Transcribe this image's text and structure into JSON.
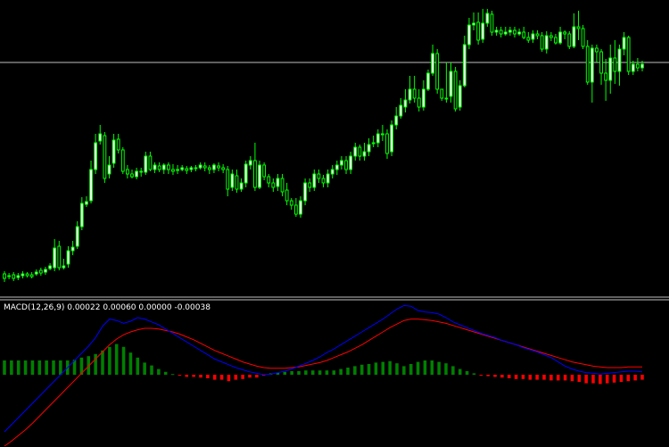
{
  "colors": {
    "background": "#000000",
    "bull_candle": "#ffffff",
    "bear_candle": "#000000",
    "candle_outline": "#00ff00",
    "hline": "#c0c0c0",
    "separator": "#c0c0c0",
    "hist_up": "#008000",
    "hist_down": "#ff0000",
    "macd_line": "#0000ff",
    "signal_line": "#ff0000",
    "label_text": "#ffffff"
  },
  "macd_label": {
    "name": "MACD(12,26,9)",
    "values": "0.00022 0.00060 0.00000 -0.00038"
  },
  "chart_data": [
    {
      "type": "candlestick",
      "hline_level": 70,
      "ylim": [
        0,
        330
      ],
      "candles": [
        [
          307,
          312,
          316,
          304
        ],
        [
          309,
          310,
          313,
          306
        ],
        [
          308,
          312,
          315,
          305
        ],
        [
          311,
          309,
          314,
          306
        ],
        [
          309,
          307,
          312,
          304
        ],
        [
          307,
          309,
          311,
          305
        ],
        [
          308,
          310,
          312,
          305
        ],
        [
          307,
          305,
          309,
          302
        ],
        [
          303,
          306,
          309,
          300
        ],
        [
          305,
          302,
          308,
          299
        ],
        [
          301,
          298,
          303,
          295
        ],
        [
          300,
          278,
          304,
          268
        ],
        [
          276,
          300,
          303,
          270
        ],
        [
          300,
          298,
          302,
          290
        ],
        [
          296,
          281,
          300,
          276
        ],
        [
          281,
          277,
          286,
          270
        ],
        [
          276,
          254,
          279,
          248
        ],
        [
          254,
          228,
          258,
          221
        ],
        [
          229,
          226,
          232,
          220
        ],
        [
          225,
          190,
          228,
          180
        ],
        [
          190,
          160,
          195,
          150
        ],
        [
          158,
          150,
          162,
          140
        ],
        [
          152,
          200,
          205,
          148
        ],
        [
          195,
          185,
          200,
          175
        ],
        [
          183,
          157,
          188,
          150
        ],
        [
          156,
          168,
          172,
          150
        ],
        [
          168,
          192,
          195,
          165
        ],
        [
          190,
          195,
          200,
          185
        ],
        [
          195,
          198,
          200,
          190
        ],
        [
          198,
          192,
          201,
          188
        ],
        [
          192,
          193,
          198,
          188
        ],
        [
          193,
          175,
          196,
          170
        ],
        [
          175,
          190,
          192,
          170
        ],
        [
          190,
          185,
          194,
          182
        ],
        [
          186,
          190,
          193,
          182
        ],
        [
          190,
          185,
          195,
          183
        ],
        [
          185,
          190,
          195,
          182
        ],
        [
          190,
          192,
          196,
          184
        ],
        [
          191,
          190,
          195,
          185
        ],
        [
          190,
          188,
          192,
          185
        ],
        [
          189,
          191,
          195,
          186
        ],
        [
          190,
          188,
          193,
          186
        ],
        [
          188,
          188,
          192,
          185
        ],
        [
          188,
          185,
          190,
          182
        ],
        [
          186,
          188,
          192,
          182
        ],
        [
          188,
          190,
          195,
          185
        ],
        [
          190,
          185,
          194,
          183
        ],
        [
          186,
          188,
          192,
          182
        ],
        [
          188,
          190,
          194,
          184
        ],
        [
          190,
          212,
          220,
          186
        ],
        [
          210,
          195,
          214,
          190
        ],
        [
          197,
          212,
          216,
          190
        ],
        [
          212,
          205,
          215,
          200
        ],
        [
          205,
          184,
          210,
          180
        ],
        [
          185,
          180,
          190,
          175
        ],
        [
          180,
          210,
          214,
          160
        ],
        [
          210,
          185,
          212,
          180
        ],
        [
          185,
          198,
          202,
          182
        ],
        [
          198,
          205,
          210,
          195
        ],
        [
          205,
          210,
          215,
          200
        ],
        [
          209,
          200,
          214,
          195
        ],
        [
          200,
          215,
          220,
          195
        ],
        [
          213,
          225,
          230,
          205
        ],
        [
          225,
          230,
          235,
          222
        ],
        [
          230,
          240,
          243,
          222
        ],
        [
          240,
          225,
          244,
          220
        ],
        [
          225,
          205,
          230,
          200
        ],
        [
          205,
          210,
          215,
          200
        ],
        [
          210,
          195,
          214,
          190
        ],
        [
          195,
          200,
          205,
          190
        ],
        [
          200,
          205,
          210,
          196
        ],
        [
          205,
          195,
          210,
          190
        ],
        [
          195,
          190,
          200,
          185
        ],
        [
          190,
          185,
          196,
          180
        ],
        [
          185,
          180,
          190,
          175
        ],
        [
          180,
          190,
          195,
          175
        ],
        [
          190,
          175,
          195,
          170
        ],
        [
          175,
          165,
          180,
          160
        ],
        [
          165,
          175,
          180,
          162
        ],
        [
          175,
          170,
          180,
          160
        ],
        [
          170,
          162,
          175,
          155
        ],
        [
          160,
          160,
          165,
          152
        ],
        [
          160,
          150,
          165,
          145
        ],
        [
          150,
          150,
          158,
          140
        ],
        [
          150,
          172,
          178,
          145
        ],
        [
          170,
          140,
          175,
          135
        ],
        [
          140,
          130,
          145,
          120
        ],
        [
          130,
          118,
          133,
          110
        ],
        [
          120,
          112,
          126,
          100
        ],
        [
          112,
          100,
          116,
          85
        ],
        [
          100,
          110,
          115,
          85
        ],
        [
          110,
          120,
          125,
          100
        ],
        [
          120,
          100,
          124,
          90
        ],
        [
          100,
          82,
          102,
          78
        ],
        [
          82,
          60,
          85,
          50
        ],
        [
          60,
          100,
          105,
          55
        ],
        [
          100,
          110,
          113,
          100
        ],
        [
          110,
          110,
          115,
          70
        ],
        [
          108,
          80,
          115,
          70
        ],
        [
          80,
          122,
          125,
          75
        ],
        [
          120,
          96,
          124,
          90
        ],
        [
          96,
          50,
          98,
          40
        ],
        [
          50,
          28,
          55,
          20
        ],
        [
          28,
          26,
          34,
          14
        ],
        [
          25,
          45,
          50,
          14
        ],
        [
          44,
          26,
          48,
          10
        ],
        [
          26,
          15,
          30,
          10
        ],
        [
          16,
          36,
          40,
          12
        ],
        [
          36,
          34,
          40,
          30
        ],
        [
          34,
          38,
          42,
          30
        ],
        [
          38,
          36,
          40,
          30
        ],
        [
          36,
          34,
          40,
          30
        ],
        [
          34,
          38,
          42,
          30
        ],
        [
          38,
          36,
          40,
          32
        ],
        [
          36,
          42,
          44,
          30
        ],
        [
          42,
          45,
          48,
          36
        ],
        [
          44,
          38,
          48,
          34
        ],
        [
          38,
          40,
          44,
          34
        ],
        [
          40,
          55,
          58,
          36
        ],
        [
          55,
          40,
          60,
          35
        ],
        [
          40,
          42,
          46,
          36
        ],
        [
          42,
          48,
          50,
          38
        ],
        [
          48,
          36,
          50,
          30
        ],
        [
          36,
          38,
          44,
          34
        ],
        [
          38,
          52,
          55,
          35
        ],
        [
          52,
          30,
          54,
          15
        ],
        [
          30,
          32,
          45,
          12
        ],
        [
          32,
          52,
          55,
          28
        ],
        [
          52,
          92,
          95,
          45
        ],
        [
          92,
          54,
          115,
          50
        ],
        [
          54,
          58,
          70,
          50
        ],
        [
          58,
          82,
          95,
          55
        ],
        [
          82,
          90,
          113,
          66
        ],
        [
          90,
          65,
          105,
          50
        ],
        [
          65,
          80,
          94,
          45
        ],
        [
          80,
          55,
          96,
          50
        ],
        [
          55,
          42,
          62,
          36
        ],
        [
          42,
          80,
          84,
          40
        ],
        [
          80,
          72,
          84,
          68
        ],
        [
          72,
          76,
          80,
          65
        ],
        [
          76,
          72,
          80,
          68
        ]
      ]
    },
    {
      "type": "macd",
      "params": [
        12,
        26,
        9
      ],
      "ylim": [
        -0.001,
        0.001
      ],
      "hist": [
        0.0002,
        0.0002,
        0.0002,
        0.0002,
        0.0002,
        0.0002,
        0.0002,
        0.0002,
        0.0002,
        0.0002,
        0.00021,
        0.00024,
        0.00026,
        0.00029,
        0.00034,
        0.00039,
        0.00043,
        0.00039,
        0.00031,
        0.00024,
        0.00017,
        0.00013,
        8e-05,
        4e-05,
        1e-05,
        -1e-05,
        -3e-05,
        -3e-05,
        -4e-05,
        -5e-05,
        -7e-05,
        -7e-05,
        -9e-05,
        -7e-05,
        -6e-05,
        -4e-05,
        -4e-05,
        -1e-05,
        2e-05,
        3e-05,
        4e-05,
        5e-05,
        5e-05,
        6e-05,
        6e-05,
        6e-05,
        6e-05,
        6e-05,
        8e-05,
        0.0001,
        0.00012,
        0.00014,
        0.00015,
        0.00017,
        0.00018,
        0.00019,
        0.00016,
        0.00012,
        0.00015,
        0.00018,
        0.0002,
        0.0002,
        0.00018,
        0.00016,
        0.00012,
        8e-05,
        5e-05,
        2e-05,
        -1e-05,
        -2e-05,
        -3e-05,
        -4e-05,
        -5e-05,
        -6e-05,
        -6e-05,
        -7e-05,
        -7e-05,
        -7e-05,
        -8e-05,
        -8e-05,
        -8e-05,
        -9e-05,
        -0.0001,
        -0.00012,
        -0.00012,
        -0.00013,
        -0.00012,
        -0.00011,
        -0.0001,
        -9e-05,
        -8e-05,
        -7e-05
      ],
      "macd": [
        -0.0008,
        -0.0007,
        -0.0006,
        -0.0005,
        -0.0004,
        -0.0003,
        -0.0002,
        -0.0001,
        0.0,
        0.0001,
        0.0002,
        0.0003,
        0.0004,
        0.00052,
        0.00068,
        0.00078,
        0.00076,
        0.00072,
        0.00075,
        0.0008,
        0.00078,
        0.00074,
        0.0007,
        0.00064,
        0.00058,
        0.00052,
        0.00046,
        0.0004,
        0.00034,
        0.00028,
        0.00022,
        0.00018,
        0.00014,
        0.0001,
        7e-05,
        4e-05,
        2e-05,
        0.0,
        1e-05,
        3e-05,
        5e-05,
        8e-05,
        0.00012,
        0.00016,
        0.0002,
        0.00025,
        0.00031,
        0.00036,
        0.00042,
        0.00048,
        0.00054,
        0.0006,
        0.00066,
        0.00072,
        0.00078,
        0.00085,
        0.00092,
        0.00097,
        0.00096,
        0.0009,
        0.00088,
        0.00087,
        0.00085,
        0.0008,
        0.00074,
        0.0007,
        0.00066,
        0.00062,
        0.00058,
        0.00055,
        0.00052,
        0.00048,
        0.00045,
        0.00042,
        0.00038,
        0.00035,
        0.00032,
        0.00028,
        0.00024,
        0.00018,
        0.00012,
        8e-05,
        5e-05,
        3e-05,
        2e-05,
        1e-05,
        2e-05,
        3e-05,
        4e-05,
        5e-05,
        5e-05,
        4e-05
      ],
      "signal": [
        -0.001,
        -0.00093,
        -0.00085,
        -0.00077,
        -0.00068,
        -0.00058,
        -0.00048,
        -0.00038,
        -0.00028,
        -0.00018,
        -8e-05,
        2e-05,
        0.00012,
        0.00022,
        0.00032,
        0.00042,
        0.0005,
        0.00056,
        0.0006,
        0.00063,
        0.00065,
        0.00065,
        0.00064,
        0.00062,
        0.0006,
        0.00057,
        0.00053,
        0.00049,
        0.00044,
        0.00039,
        0.00034,
        0.0003,
        0.00026,
        0.00022,
        0.00018,
        0.00015,
        0.00012,
        0.0001,
        9e-05,
        9e-05,
        9e-05,
        0.0001,
        0.00011,
        0.00013,
        0.00015,
        0.00017,
        0.0002,
        0.00024,
        0.00028,
        0.00032,
        0.00037,
        0.00042,
        0.00048,
        0.00054,
        0.0006,
        0.00066,
        0.00071,
        0.00076,
        0.00078,
        0.00078,
        0.00077,
        0.00076,
        0.00074,
        0.00072,
        0.00069,
        0.00066,
        0.00063,
        0.0006,
        0.00057,
        0.00054,
        0.00051,
        0.00048,
        0.00045,
        0.00042,
        0.00039,
        0.00036,
        0.00033,
        0.0003,
        0.00027,
        0.00024,
        0.00021,
        0.00018,
        0.00016,
        0.00014,
        0.00012,
        0.00011,
        0.0001,
        0.0001,
        0.0001,
        0.00011,
        0.00011,
        0.00011
      ]
    }
  ]
}
